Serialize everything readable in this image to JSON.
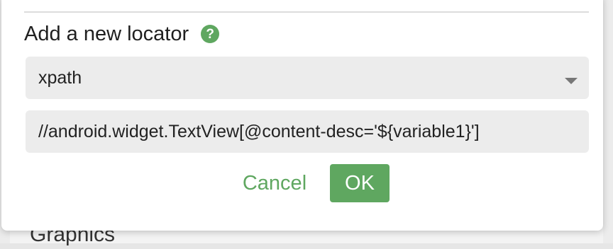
{
  "background": {
    "section_label": "Graphics"
  },
  "dialog": {
    "title": "Add a new locator",
    "help_icon": "?",
    "locator_type": {
      "selected": "xpath"
    },
    "locator_value": {
      "value": "//android.widget.TextView[@content-desc='${variable1}']"
    },
    "buttons": {
      "cancel_label": "Cancel",
      "ok_label": "OK"
    }
  },
  "colors": {
    "accent": "#5fa760",
    "field_bg": "#ececec",
    "text": "#222222"
  },
  "icons": {
    "help": "question-circle-icon",
    "dropdown": "caret-down-icon"
  }
}
